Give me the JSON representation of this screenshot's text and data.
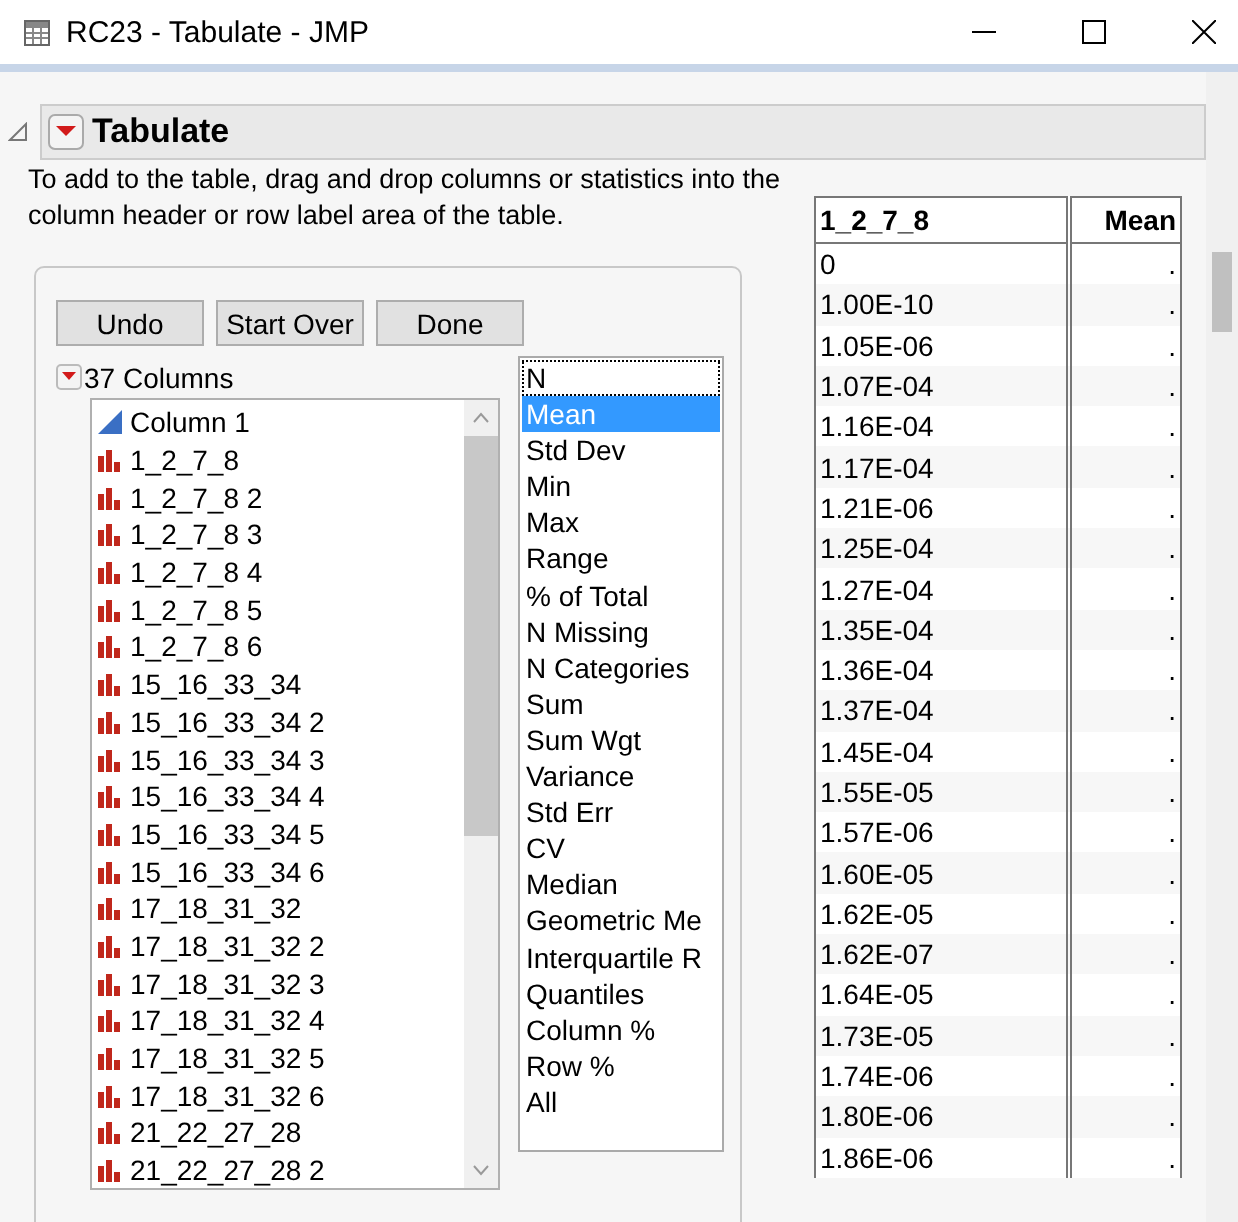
{
  "window": {
    "title": "RC23 - Tabulate - JMP"
  },
  "outline": {
    "title": "Tabulate",
    "expanded": true
  },
  "instructions": "To add to the table, drag and drop columns or statistics into the column header or row label area of the table.",
  "buttons": [
    "Undo",
    "Start Over",
    "Done"
  ],
  "columns_header": "37 Columns",
  "columns": [
    {
      "name": "Column 1",
      "kind": "continuous"
    },
    {
      "name": "1_2_7_8",
      "kind": "nominal"
    },
    {
      "name": "1_2_7_8 2",
      "kind": "nominal"
    },
    {
      "name": "1_2_7_8 3",
      "kind": "nominal"
    },
    {
      "name": "1_2_7_8 4",
      "kind": "nominal"
    },
    {
      "name": "1_2_7_8 5",
      "kind": "nominal"
    },
    {
      "name": "1_2_7_8 6",
      "kind": "nominal"
    },
    {
      "name": "15_16_33_34",
      "kind": "nominal"
    },
    {
      "name": "15_16_33_34 2",
      "kind": "nominal"
    },
    {
      "name": "15_16_33_34 3",
      "kind": "nominal"
    },
    {
      "name": "15_16_33_34 4",
      "kind": "nominal"
    },
    {
      "name": "15_16_33_34 5",
      "kind": "nominal"
    },
    {
      "name": "15_16_33_34 6",
      "kind": "nominal"
    },
    {
      "name": "17_18_31_32",
      "kind": "nominal"
    },
    {
      "name": "17_18_31_32 2",
      "kind": "nominal"
    },
    {
      "name": "17_18_31_32 3",
      "kind": "nominal"
    },
    {
      "name": "17_18_31_32 4",
      "kind": "nominal"
    },
    {
      "name": "17_18_31_32 5",
      "kind": "nominal"
    },
    {
      "name": "17_18_31_32 6",
      "kind": "nominal"
    },
    {
      "name": "21_22_27_28",
      "kind": "nominal"
    },
    {
      "name": "21_22_27_28 2",
      "kind": "nominal"
    }
  ],
  "statistics": [
    {
      "label": "N",
      "selected": false,
      "focused": true
    },
    {
      "label": "Mean",
      "selected": true,
      "focused": false
    },
    {
      "label": "Std Dev",
      "selected": false,
      "focused": false
    },
    {
      "label": "Min",
      "selected": false,
      "focused": false
    },
    {
      "label": "Max",
      "selected": false,
      "focused": false
    },
    {
      "label": "Range",
      "selected": false,
      "focused": false
    },
    {
      "label": "% of Total",
      "selected": false,
      "focused": false
    },
    {
      "label": "N Missing",
      "selected": false,
      "focused": false
    },
    {
      "label": "N Categories",
      "selected": false,
      "focused": false
    },
    {
      "label": "Sum",
      "selected": false,
      "focused": false
    },
    {
      "label": "Sum Wgt",
      "selected": false,
      "focused": false
    },
    {
      "label": "Variance",
      "selected": false,
      "focused": false
    },
    {
      "label": "Std Err",
      "selected": false,
      "focused": false
    },
    {
      "label": "CV",
      "selected": false,
      "focused": false
    },
    {
      "label": "Median",
      "selected": false,
      "focused": false
    },
    {
      "label": "Geometric Me",
      "selected": false,
      "focused": false
    },
    {
      "label": "Interquartile R",
      "selected": false,
      "focused": false
    },
    {
      "label": "Quantiles",
      "selected": false,
      "focused": false
    },
    {
      "label": "Column %",
      "selected": false,
      "focused": false
    },
    {
      "label": "Row %",
      "selected": false,
      "focused": false
    },
    {
      "label": "All",
      "selected": false,
      "focused": false
    }
  ],
  "table": {
    "columns": [
      "1_2_7_8",
      "Mean"
    ],
    "rows": [
      [
        "0",
        "."
      ],
      [
        "1.00E-10",
        "."
      ],
      [
        "1.05E-06",
        "."
      ],
      [
        "1.07E-04",
        "."
      ],
      [
        "1.16E-04",
        "."
      ],
      [
        "1.17E-04",
        "."
      ],
      [
        "1.21E-06",
        "."
      ],
      [
        "1.25E-04",
        "."
      ],
      [
        "1.27E-04",
        "."
      ],
      [
        "1.35E-04",
        "."
      ],
      [
        "1.36E-04",
        "."
      ],
      [
        "1.37E-04",
        "."
      ],
      [
        "1.45E-04",
        "."
      ],
      [
        "1.55E-05",
        "."
      ],
      [
        "1.57E-06",
        "."
      ],
      [
        "1.60E-05",
        "."
      ],
      [
        "1.62E-05",
        "."
      ],
      [
        "1.62E-07",
        "."
      ],
      [
        "1.64E-05",
        "."
      ],
      [
        "1.73E-05",
        "."
      ],
      [
        "1.74E-06",
        "."
      ],
      [
        "1.80E-06",
        "."
      ],
      [
        "1.86E-06",
        "."
      ]
    ]
  }
}
